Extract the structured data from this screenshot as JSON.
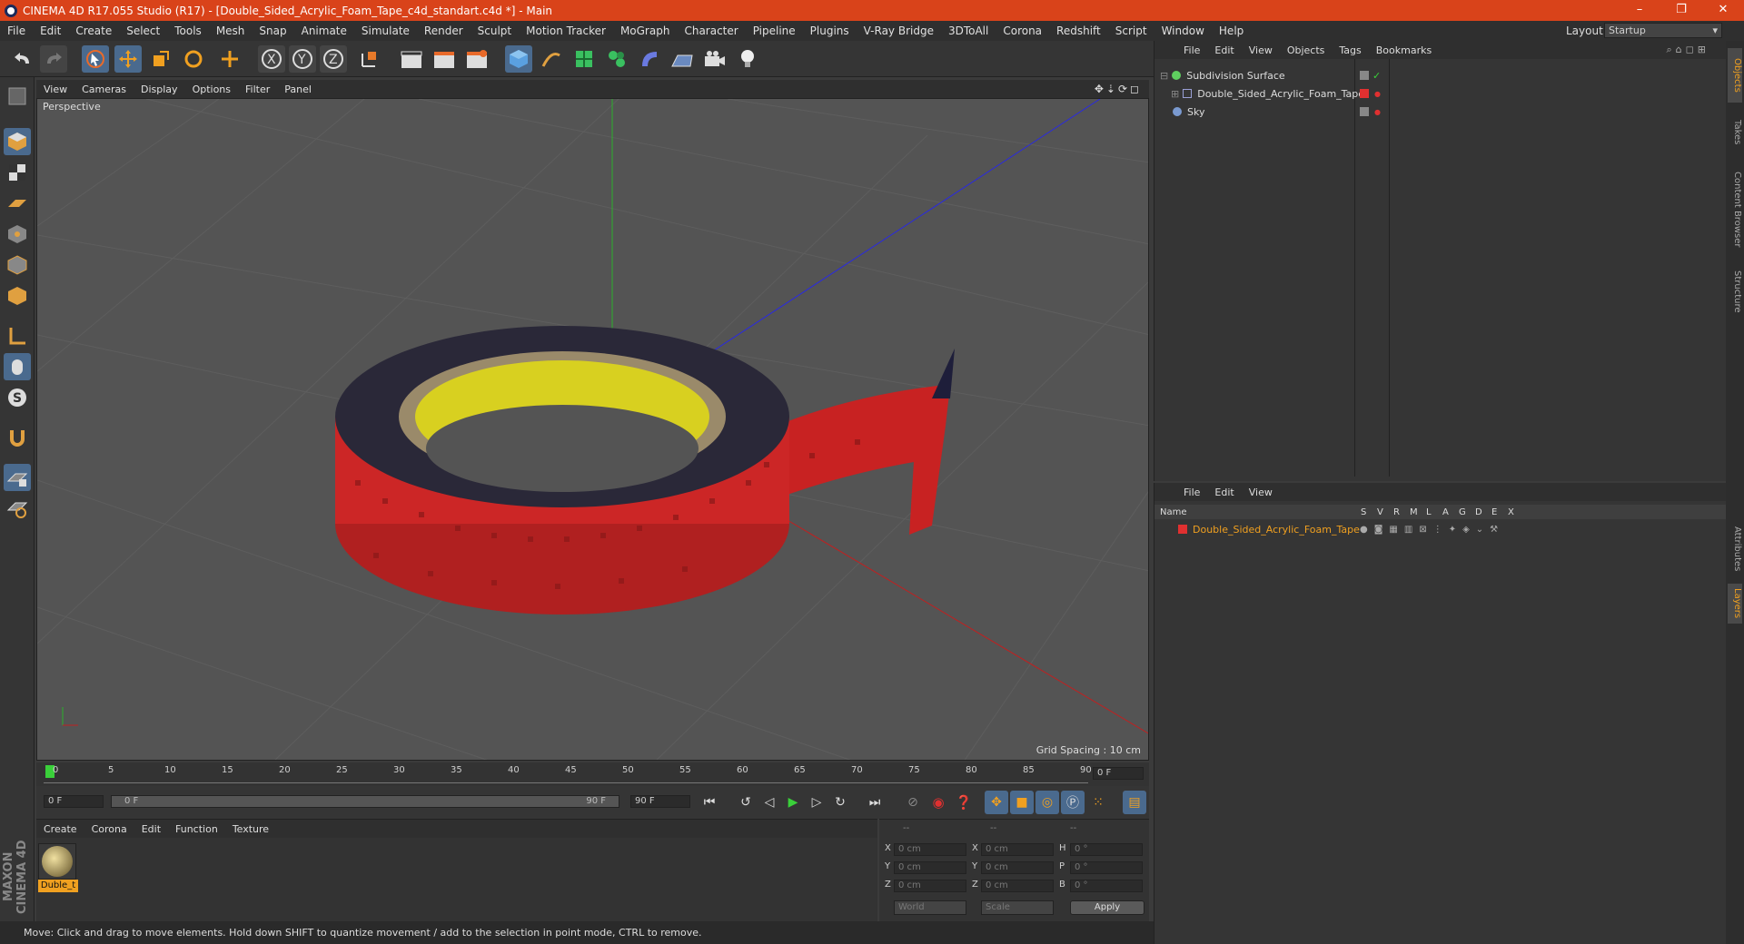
{
  "window": {
    "title": "CINEMA 4D R17.055 Studio (R17) - [Double_Sided_Acrylic_Foam_Tape_c4d_standart.c4d *] - Main",
    "controls": [
      "–",
      "❐",
      "✕"
    ]
  },
  "menu": {
    "items": [
      "File",
      "Edit",
      "Create",
      "Select",
      "Tools",
      "Mesh",
      "Snap",
      "Animate",
      "Simulate",
      "Render",
      "Sculpt",
      "Motion Tracker",
      "MoGraph",
      "Character",
      "Pipeline",
      "Plugins",
      "V-Ray Bridge",
      "3DToAll",
      "Corona",
      "Redshift",
      "Script",
      "Window",
      "Help"
    ],
    "layout_label": "Layout:",
    "layout_value": "Startup"
  },
  "viewport": {
    "menu": [
      "View",
      "Cameras",
      "Display",
      "Options",
      "Filter",
      "Panel"
    ],
    "label": "Perspective",
    "grid_spacing": "Grid Spacing : 10 cm"
  },
  "timeline": {
    "ticks": [
      "0",
      "5",
      "10",
      "15",
      "20",
      "25",
      "30",
      "35",
      "40",
      "45",
      "50",
      "55",
      "60",
      "65",
      "70",
      "75",
      "80",
      "85",
      "90"
    ],
    "current_frame": "0 F"
  },
  "playback": {
    "start_field": "0 F",
    "range_start": "0 F",
    "range_end": "90 F",
    "end_field": "90 F"
  },
  "material_panel": {
    "menu": [
      "Create",
      "Corona",
      "Edit",
      "Function",
      "Texture"
    ],
    "material_name": "Duble_t"
  },
  "coords": {
    "headers": [
      "--",
      "--",
      "--"
    ],
    "rows": [
      {
        "a": "X",
        "av": "0 cm",
        "b": "X",
        "bv": "0 cm",
        "c": "H",
        "cv": "0 °"
      },
      {
        "a": "Y",
        "av": "0 cm",
        "b": "Y",
        "bv": "0 cm",
        "c": "P",
        "cv": "0 °"
      },
      {
        "a": "Z",
        "av": "0 cm",
        "b": "Z",
        "bv": "0 cm",
        "c": "B",
        "cv": "0 °"
      }
    ],
    "world": "World",
    "scale": "Scale",
    "apply": "Apply"
  },
  "objects_panel": {
    "menu": [
      "File",
      "Edit",
      "View",
      "Objects",
      "Tags",
      "Bookmarks"
    ],
    "items": [
      {
        "name": "Subdivision Surface",
        "color": "#5fcf5f"
      },
      {
        "name": "Double_Sided_Acrylic_Foam_Tape",
        "color": "#9aa0d6"
      },
      {
        "name": "Sky",
        "color": "#7a9ad0"
      }
    ]
  },
  "layers_panel": {
    "menu": [
      "File",
      "Edit",
      "View"
    ],
    "columns": [
      "Name",
      "S",
      "V",
      "R",
      "M",
      "L",
      "A",
      "G",
      "D",
      "E",
      "X"
    ],
    "layer_name": "Double_Sided_Acrylic_Foam_Tape",
    "layer_color": "#e03030"
  },
  "right_tabs": [
    "Objects",
    "Takes",
    "Content Browser",
    "Structure",
    "Attributes",
    "Layers"
  ],
  "status": "Move: Click and drag to move elements. Hold down SHIFT to quantize movement / add to the selection in point mode, CTRL to remove.",
  "brand": "MAXON CINEMA 4D",
  "colors": {
    "accent": "#d9431a",
    "selection": "#4a6a8e",
    "tape_red": "#d42a2a",
    "tape_core": "#d8d020"
  }
}
